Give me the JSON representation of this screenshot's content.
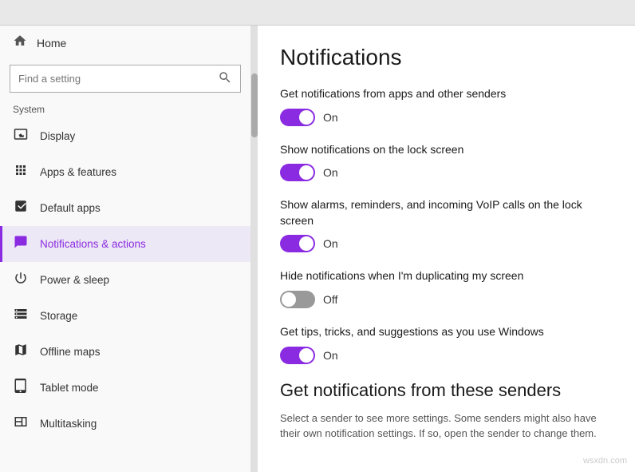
{
  "topbar": {},
  "sidebar": {
    "home_label": "Home",
    "search_placeholder": "Find a setting",
    "system_label": "System",
    "nav_items": [
      {
        "id": "display",
        "label": "Display",
        "icon": "display"
      },
      {
        "id": "apps",
        "label": "Apps & features",
        "icon": "apps"
      },
      {
        "id": "default-apps",
        "label": "Default apps",
        "icon": "default"
      },
      {
        "id": "notifications",
        "label": "Notifications & actions",
        "icon": "notifications",
        "active": true
      },
      {
        "id": "power",
        "label": "Power & sleep",
        "icon": "power"
      },
      {
        "id": "storage",
        "label": "Storage",
        "icon": "storage"
      },
      {
        "id": "offline-maps",
        "label": "Offline maps",
        "icon": "maps"
      },
      {
        "id": "tablet-mode",
        "label": "Tablet mode",
        "icon": "tablet"
      },
      {
        "id": "multitasking",
        "label": "Multitasking",
        "icon": "multitasking"
      }
    ]
  },
  "content": {
    "title": "Notifications",
    "settings": [
      {
        "id": "notif-apps",
        "label": "Get notifications from apps and other senders",
        "state": "on",
        "state_label": "On"
      },
      {
        "id": "notif-lock",
        "label": "Show notifications on the lock screen",
        "state": "on",
        "state_label": "On"
      },
      {
        "id": "notif-alarms",
        "label": "Show alarms, reminders, and incoming VoIP calls on the lock screen",
        "state": "on",
        "state_label": "On"
      },
      {
        "id": "notif-duplicate",
        "label": "Hide notifications when I'm duplicating my screen",
        "state": "off",
        "state_label": "Off"
      },
      {
        "id": "notif-tips",
        "label": "Get tips, tricks, and suggestions as you use Windows",
        "state": "on",
        "state_label": "On"
      }
    ],
    "senders_title": "Get notifications from these senders",
    "senders_desc": "Select a sender to see more settings. Some senders might also have their own notification settings. If so, open the sender to change them.",
    "watermark": "wsxdn.com"
  }
}
